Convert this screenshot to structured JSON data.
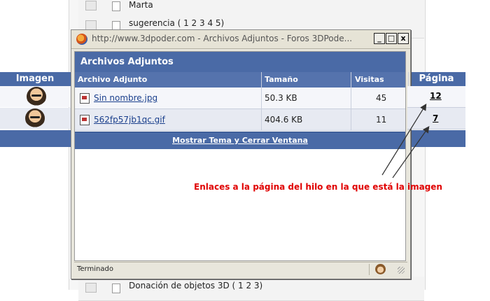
{
  "background": {
    "rows": [
      {
        "text": "Marta"
      },
      {
        "text": "sugerencia ( 1 2 3 4 5)"
      },
      {
        "text": "Donación de objetos 3D ( 1 2 3)"
      }
    ],
    "outer_table": {
      "header_image": "Imagen",
      "header_page": "Página"
    }
  },
  "window": {
    "title": "http://www.3dpoder.com - Archivos Adjuntos - Foros 3DPode...",
    "buttons": {
      "minimize": "_",
      "maximize": "□",
      "close": "x"
    },
    "panel_title": "Archivos Adjuntos",
    "columns": [
      "Archivo Adjunto",
      "Tamaño",
      "Visitas",
      "Página"
    ],
    "rows": [
      {
        "file": "Sin nombre.jpg",
        "size": "50.3 KB",
        "visits": "45",
        "page": "12"
      },
      {
        "file": "562fp57jb1qc.gif",
        "size": "404.6 KB",
        "visits": "11",
        "page": "7"
      }
    ],
    "footer_link": "Mostrar Tema y Cerrar Ventana",
    "status": "Terminado"
  },
  "annotation": "Enlaces a la página del hilo en la que está la imagen",
  "colors": {
    "header_blue": "#4a6aa6",
    "annotation_red": "#e00000"
  }
}
